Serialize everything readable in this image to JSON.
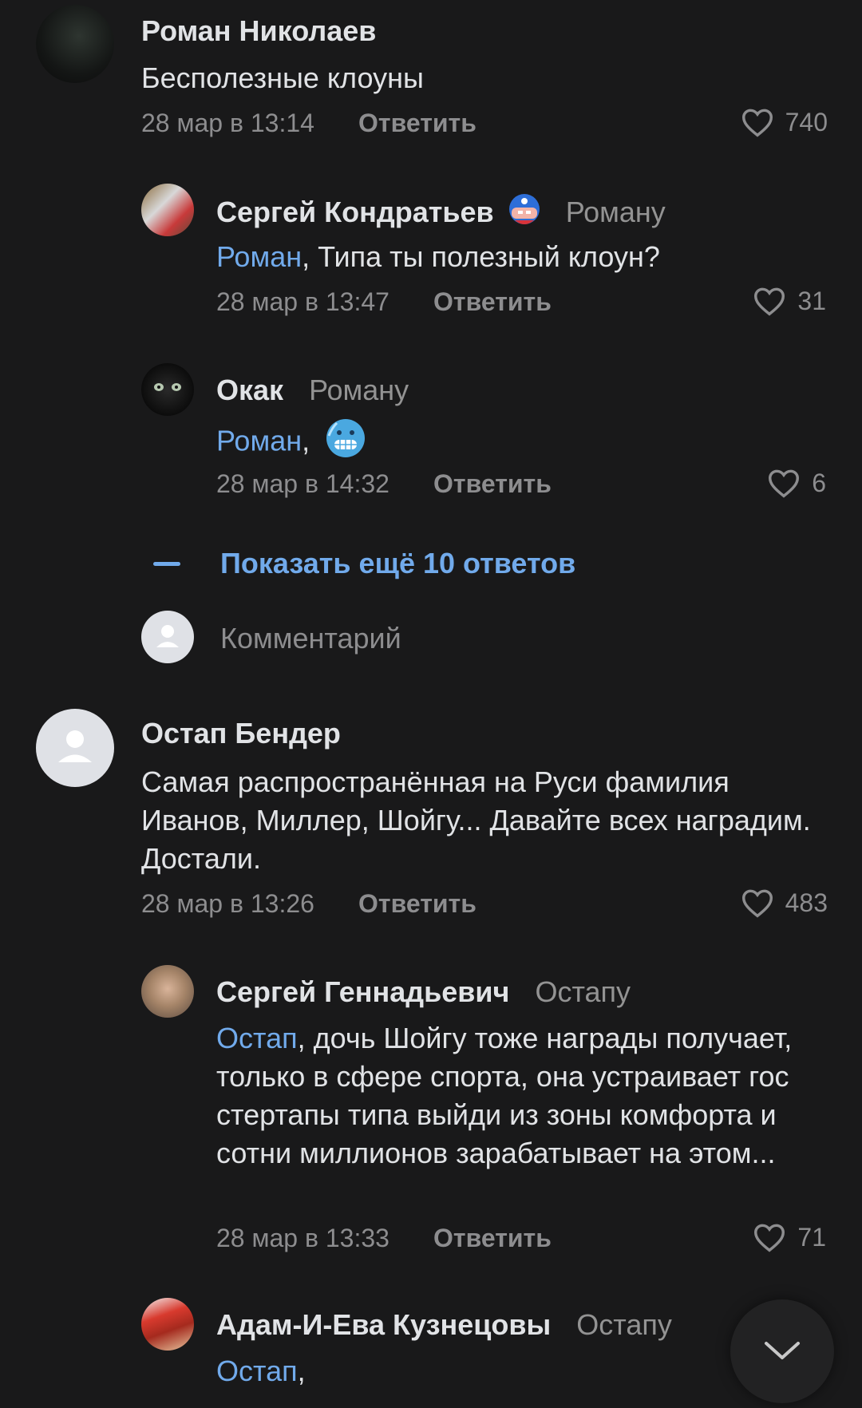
{
  "comments": [
    {
      "author": "Роман Николаев",
      "text": "Бесполезные клоуны",
      "date": "28 мар в 13:14",
      "reply_label": "Ответить",
      "likes": "740"
    },
    {
      "author": "Сергей Кондратьев",
      "to": "Роману",
      "mention": "Роман",
      "text": ", Типа ты полезный клоун?",
      "date": "28 мар в 13:47",
      "reply_label": "Ответить",
      "likes": "31"
    },
    {
      "author": "Окак",
      "to": "Роману",
      "mention": "Роман",
      "text": ",",
      "date": "28 мар в 14:32",
      "reply_label": "Ответить",
      "likes": "6"
    },
    {
      "author": "Остап Бендер",
      "text": "Самая распространённая на Руси фамилия Иванов, Миллер, Шойгу... Давайте всех наградим. Достали.",
      "date": "28 мар в 13:26",
      "reply_label": "Ответить",
      "likes": "483"
    },
    {
      "author": "Сергей Геннадьевич",
      "to": "Остапу",
      "mention": "Остап",
      "text": ", дочь Шойгу тоже награды получает, только в сфере спорта, она устраивает гос стертапы типа выйди из зоны комфорта и сотни миллионов зарабатывает на этом...",
      "date": "28 мар в 13:33",
      "reply_label": "Ответить",
      "likes": "71"
    },
    {
      "author": "Адам-И-Ева Кузнецовы",
      "to": "Остапу",
      "mention": "Остап",
      "text": ","
    }
  ],
  "show_more": "Показать ещё 10 ответов",
  "comment_placeholder": "Комментарий",
  "icons": {
    "like": "heart-icon",
    "scroll": "chevron-down-icon",
    "emoji": "freezing-face-emoji"
  },
  "colors": {
    "background": "#19191a",
    "accent": "#71aaeb",
    "secondary_text": "#8d8d8f"
  }
}
